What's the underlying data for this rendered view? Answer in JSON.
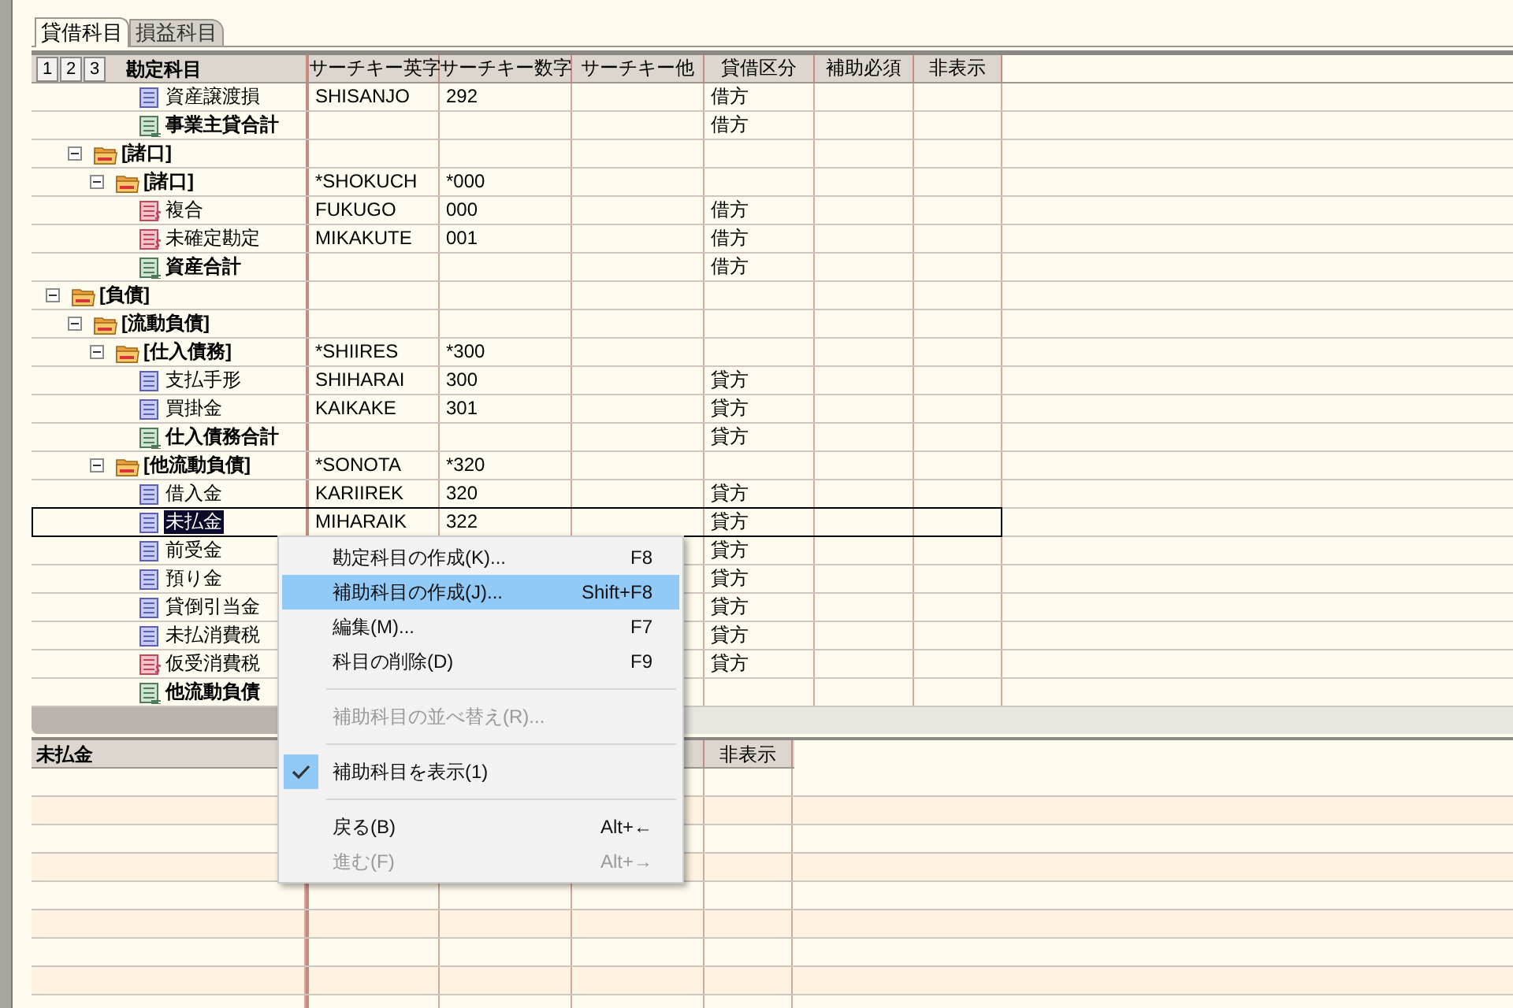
{
  "tabs": [
    {
      "label": "貸借科目",
      "selected": true
    },
    {
      "label": "損益科目",
      "selected": false
    }
  ],
  "grid": {
    "level_buttons": [
      "1",
      "2",
      "3"
    ],
    "columns": [
      {
        "label": "勘定科目"
      },
      {
        "label": "サーチキー英字"
      },
      {
        "label": "サーチキー数字"
      },
      {
        "label": "サーチキー他"
      },
      {
        "label": "貸借区分"
      },
      {
        "label": "補助必須"
      },
      {
        "label": "非表示"
      }
    ],
    "tree": [
      {
        "children": [
          {
            "children": [
              {
                "children": [
                  {
                    "label": "資産譲渡損",
                    "kind": "account",
                    "selected": false,
                    "cells": {
                      "search_alpha": "SHISANJO",
                      "search_num": "292",
                      "side": "借方"
                    }
                  },
                  {
                    "label": "事業主貸合計",
                    "kind": "total",
                    "selected": false,
                    "cells": {
                      "side": "借方"
                    }
                  }
                ]
              }
            ]
          },
          {
            "label": "[諸口]",
            "kind": "folder",
            "expanded": true,
            "selected": false,
            "children": [
              {
                "label": "[諸口]",
                "kind": "folder",
                "expanded": true,
                "selected": false,
                "cells": {
                  "search_alpha": "*SHOKUCH",
                  "search_num": "*000"
                },
                "children": [
                  {
                    "label": "複合",
                    "kind": "special",
                    "selected": false,
                    "cells": {
                      "search_alpha": "FUKUGO",
                      "search_num": "000",
                      "side": "借方"
                    }
                  },
                  {
                    "label": "未確定勘定",
                    "kind": "special",
                    "selected": false,
                    "cells": {
                      "search_alpha": "MIKAKUTE",
                      "search_num": "001",
                      "side": "借方"
                    }
                  },
                  {
                    "label": "資産合計",
                    "kind": "total",
                    "selected": false,
                    "cells": {
                      "side": "借方"
                    }
                  }
                ]
              }
            ]
          }
        ]
      },
      {
        "label": "[負債]",
        "kind": "folder",
        "expanded": true,
        "selected": false,
        "children": [
          {
            "label": "[流動負債]",
            "kind": "folder",
            "expanded": true,
            "selected": false,
            "children": [
              {
                "label": "[仕入債務]",
                "kind": "folder",
                "expanded": true,
                "selected": false,
                "cells": {
                  "search_alpha": "*SHIIRES",
                  "search_num": "*300"
                },
                "children": [
                  {
                    "label": "支払手形",
                    "kind": "account",
                    "selected": false,
                    "cells": {
                      "search_alpha": "SHIHARAI",
                      "search_num": "300",
                      "side": "貸方"
                    }
                  },
                  {
                    "label": "買掛金",
                    "kind": "account",
                    "selected": false,
                    "cells": {
                      "search_alpha": "KAIKAKE",
                      "search_num": "301",
                      "side": "貸方"
                    }
                  },
                  {
                    "label": "仕入債務合計",
                    "kind": "total",
                    "selected": false,
                    "cells": {
                      "side": "貸方"
                    }
                  }
                ]
              },
              {
                "label": "[他流動負債]",
                "kind": "folder",
                "expanded": true,
                "selected": false,
                "cells": {
                  "search_alpha": "*SONOTA",
                  "search_num": "*320"
                },
                "children": [
                  {
                    "label": "借入金",
                    "kind": "account",
                    "selected": false,
                    "cells": {
                      "search_alpha": "KARIIREK",
                      "search_num": "320",
                      "side": "貸方"
                    }
                  },
                  {
                    "label": "未払金",
                    "kind": "account",
                    "selected": true,
                    "cells": {
                      "search_alpha": "MIHARAIK",
                      "search_num": "322",
                      "side": "貸方"
                    }
                  },
                  {
                    "label": "前受金",
                    "kind": "account",
                    "selected": false,
                    "cells": {
                      "side": "貸方"
                    }
                  },
                  {
                    "label": "預り金",
                    "kind": "account",
                    "selected": false,
                    "cells": {
                      "side": "貸方"
                    }
                  },
                  {
                    "label": "貸倒引当金",
                    "kind": "account",
                    "selected": false,
                    "cells": {
                      "side": "貸方"
                    }
                  },
                  {
                    "label": "未払消費税",
                    "kind": "account",
                    "selected": false,
                    "cells": {
                      "side": "貸方"
                    }
                  },
                  {
                    "label": "仮受消費税",
                    "kind": "special",
                    "selected": false,
                    "cells": {
                      "side": "貸方"
                    }
                  },
                  {
                    "label": "他流動負債",
                    "kind": "total",
                    "selected": false
                  }
                ]
              }
            ]
          }
        ]
      }
    ]
  },
  "detail": {
    "title": "未払金",
    "column_5": "非表示"
  },
  "context_menu": [
    {
      "kind": "item",
      "label": "勘定科目の作成(K)...",
      "shortcut": "F8",
      "selected": false,
      "disabled": false,
      "checked": false
    },
    {
      "kind": "item",
      "label": "補助科目の作成(J)...",
      "shortcut": "Shift+F8",
      "selected": true,
      "disabled": false,
      "checked": false
    },
    {
      "kind": "item",
      "label": "編集(M)...",
      "shortcut": "F7",
      "selected": false,
      "disabled": false,
      "checked": false
    },
    {
      "kind": "item",
      "label": "科目の削除(D)",
      "shortcut": "F9",
      "selected": false,
      "disabled": false,
      "checked": false
    },
    {
      "kind": "separator"
    },
    {
      "kind": "item",
      "label": "補助科目の並べ替え(R)...",
      "selected": false,
      "disabled": true,
      "checked": false
    },
    {
      "kind": "separator"
    },
    {
      "kind": "item",
      "label": "補助科目を表示(1)",
      "selected": false,
      "disabled": false,
      "checked": true
    },
    {
      "kind": "separator"
    },
    {
      "kind": "item",
      "label": "戻る(B)",
      "shortcut": "Alt+←",
      "selected": false,
      "disabled": false,
      "checked": false
    },
    {
      "kind": "item",
      "label": "進む(F)",
      "shortcut": "Alt+→",
      "selected": false,
      "disabled": true,
      "checked": false
    }
  ]
}
